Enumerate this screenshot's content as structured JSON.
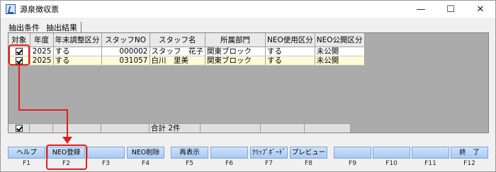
{
  "window": {
    "title": "源泉徴収票",
    "minimize": "—",
    "maximize": "☐",
    "close": "✕"
  },
  "tabs": [
    "抽出条件",
    "抽出結果"
  ],
  "grid": {
    "columns": [
      "対象",
      "年度",
      "年末調整区分",
      "スタッフNO",
      "スタッフ名",
      "所属部門",
      "NEO使用区分",
      "NEO公開区分"
    ],
    "rows": [
      {
        "checked": true,
        "year": "2025",
        "adjust": "する",
        "staff_no": "000002",
        "name": "スタッフ　花子",
        "dept": "関東ブロック",
        "neo_use": "する",
        "neo_pub": "未公開"
      },
      {
        "checked": true,
        "year": "2025",
        "adjust": "する",
        "staff_no": "031057",
        "name": "白川　里美",
        "dept": "関東ブロック",
        "neo_use": "する",
        "neo_pub": "未公開"
      }
    ],
    "footer": {
      "checked": true,
      "total": "合計  2件"
    }
  },
  "fkeys": [
    {
      "key": "F1",
      "label": "ヘルプ"
    },
    {
      "key": "F2",
      "label": "NEO登録"
    },
    {
      "key": "F3",
      "label": ""
    },
    {
      "key": "F4",
      "label": "NEO削除"
    },
    {
      "key": "F5",
      "label": "再表示"
    },
    {
      "key": "F6",
      "label": ""
    },
    {
      "key": "F7",
      "label": "ｸﾘｯﾌﾟﾎﾞｰﾄﾞ"
    },
    {
      "key": "F8",
      "label": "プレビュー"
    },
    {
      "key": "F9",
      "label": ""
    },
    {
      "key": "F10",
      "label": ""
    },
    {
      "key": "F11",
      "label": ""
    },
    {
      "key": "F12",
      "label": "終　了"
    }
  ],
  "colors": {
    "annotation": "#e01e1e",
    "grid_bg": "#ababab",
    "row_selected": "#fffbd8",
    "fkey_button": "#bcd6f6"
  }
}
